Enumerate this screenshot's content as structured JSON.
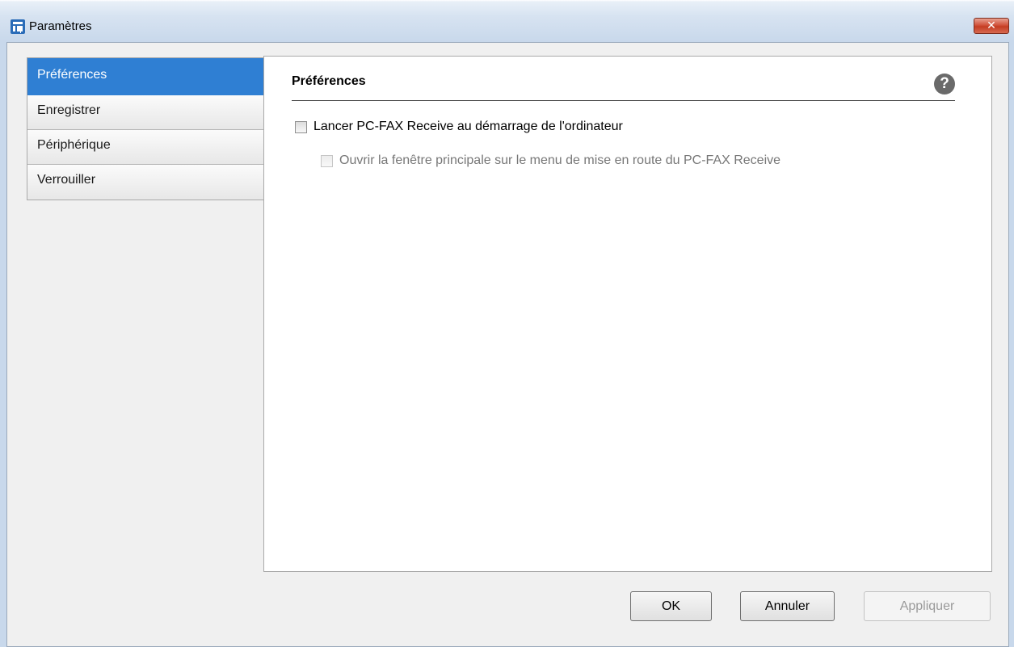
{
  "window": {
    "title": "Paramètres",
    "icon": "app-window-icon",
    "close_label": "✕"
  },
  "sidebar": {
    "selected": "Préférences",
    "items": [
      {
        "label": "Préférences"
      },
      {
        "label": "Enregistrer"
      },
      {
        "label": "Périphérique"
      },
      {
        "label": "Verrouiller"
      }
    ]
  },
  "panel": {
    "title": "Préférences",
    "help_label": "?",
    "options": [
      {
        "label": "Lancer PC-FAX Receive au démarrage de l'ordinateur",
        "checked": false,
        "enabled": true
      },
      {
        "label": "Ouvrir la fenêtre principale sur le menu de mise en route du PC-FAX Receive",
        "checked": false,
        "enabled": false
      }
    ]
  },
  "buttons": {
    "ok": "OK",
    "cancel": "Annuler",
    "apply": "Appliquer"
  },
  "colors": {
    "selection": "#2f7fd3",
    "close_button": "#c43c22"
  }
}
